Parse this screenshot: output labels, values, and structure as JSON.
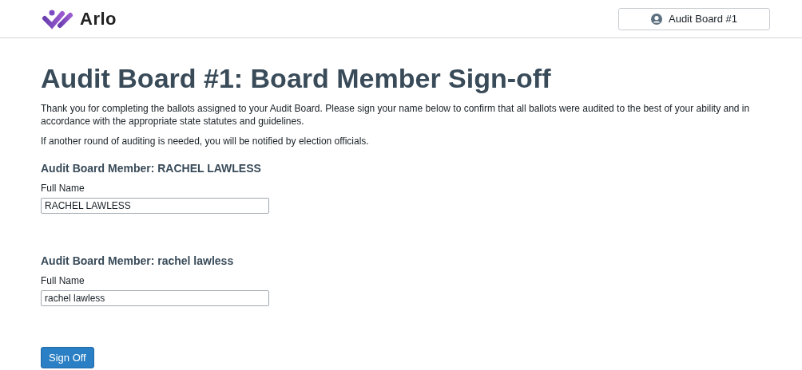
{
  "header": {
    "logo_text": "Arlo",
    "user_button": "Audit Board #1"
  },
  "title": "Audit Board #1: Board Member Sign-off",
  "paragraphs": [
    "Thank you for completing the ballots assigned to your Audit Board. Please sign your name below to confirm that all ballots were audited to the best of your ability and in accordance with the appropriate state statutes and guidelines.",
    "If another round of auditing is needed, you will be notified by election officials."
  ],
  "members": [
    {
      "heading": "Audit Board Member: RACHEL LAWLESS",
      "label": "Full Name",
      "value": "RACHEL LAWLESS"
    },
    {
      "heading": "Audit Board Member: rachel lawless",
      "label": "Full Name",
      "value": "rachel lawless"
    }
  ],
  "submit_button": "Sign Off"
}
